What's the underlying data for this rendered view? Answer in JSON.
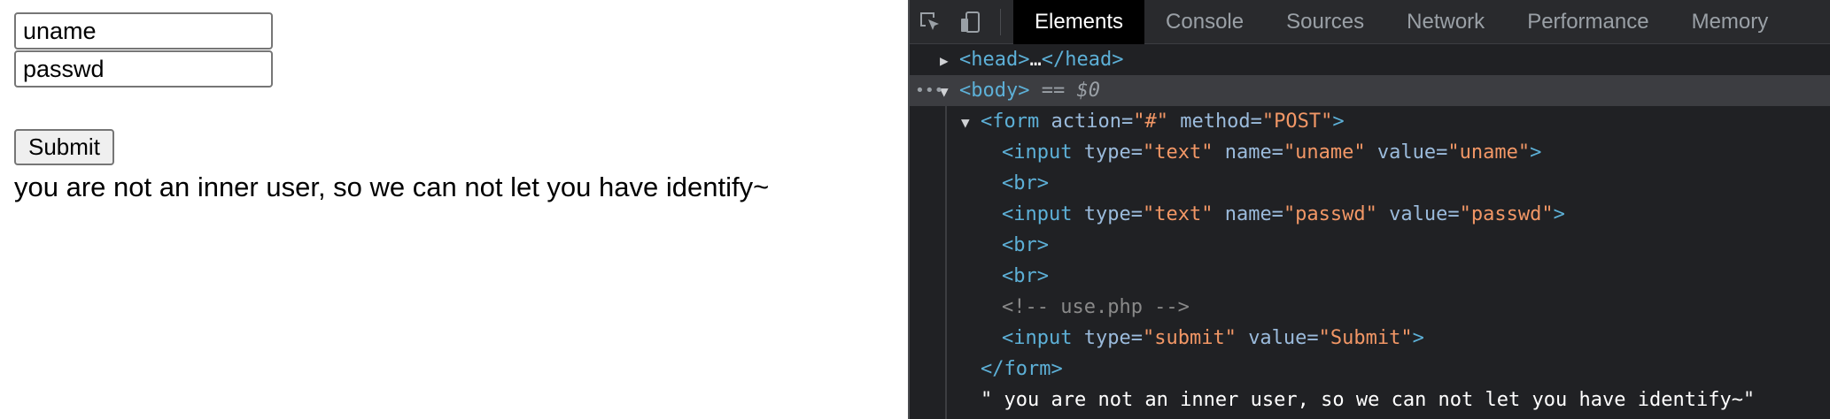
{
  "page": {
    "uname_value": "uname",
    "passwd_value": "passwd",
    "submit_label": "Submit",
    "message": "you are not an inner user, so we can not let you have identify~"
  },
  "devtools": {
    "tabs": [
      {
        "label": "Elements",
        "active": true
      },
      {
        "label": "Console",
        "active": false
      },
      {
        "label": "Sources",
        "active": false
      },
      {
        "label": "Network",
        "active": false
      },
      {
        "label": "Performance",
        "active": false
      },
      {
        "label": "Memory",
        "active": false
      }
    ],
    "tree": {
      "head_open": "<head>",
      "head_ellipsis": "…",
      "head_close": "</head>",
      "body_tag": "<body>",
      "body_eq": "==",
      "body_ref": "$0",
      "form_open_start": "<form",
      "form_action_attr": "action=",
      "form_action_val": "\"#\"",
      "form_method_attr": "method=",
      "form_method_val": "\"POST\"",
      "form_open_end": ">",
      "input_start": "<input",
      "type_attr": "type=",
      "name_attr": "name=",
      "value_attr": "value=",
      "text_val": "\"text\"",
      "uname_name_val": "\"uname\"",
      "uname_value_val": "\"uname\"",
      "passwd_name_val": "\"passwd\"",
      "passwd_value_val": "\"passwd\"",
      "submit_type_val": "\"submit\"",
      "submit_value_val": "\"Submit\"",
      "tag_end": ">",
      "br": "<br>",
      "comment": "<!-- use.php -->",
      "form_close": "</form>",
      "text_node": "\" you are not an inner user, so we can not let you have identify~\""
    }
  },
  "colors": {
    "devtools_bg": "#202124",
    "tag": "#5db0d7",
    "attr": "#9bbbdc",
    "value": "#f29766",
    "comment": "#898989"
  },
  "icons": [
    "inspect-element-icon",
    "device-toolbar-icon"
  ]
}
